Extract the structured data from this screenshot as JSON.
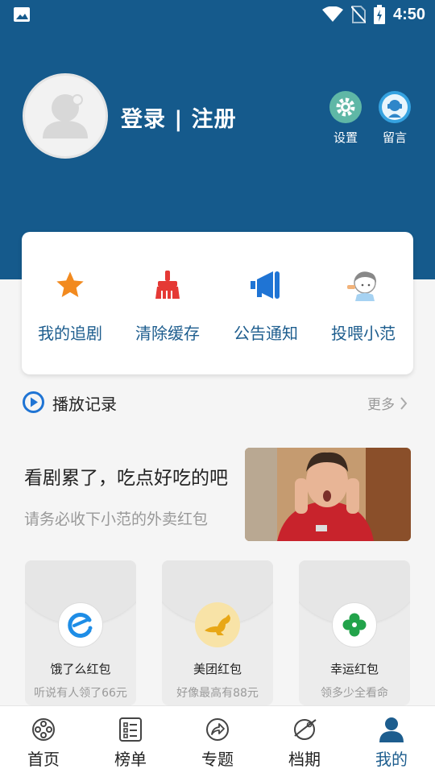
{
  "status_bar": {
    "time": "4:50"
  },
  "profile": {
    "login_label": "登录 | 注册"
  },
  "header_actions": [
    {
      "label": "设置",
      "icon": "gear-icon",
      "color": "#5fb7a6"
    },
    {
      "label": "留言",
      "icon": "headset-icon",
      "color": "#35a2e0"
    }
  ],
  "quick_actions": [
    {
      "label": "我的追剧",
      "icon": "star-icon",
      "color": "#f28a1f"
    },
    {
      "label": "清除缓存",
      "icon": "broom-icon",
      "color": "#e53935"
    },
    {
      "label": "公告通知",
      "icon": "megaphone-icon",
      "color": "#1f74d4"
    },
    {
      "label": "投喂小范",
      "icon": "girl-eating-icon",
      "color": "#f2b37a"
    }
  ],
  "history": {
    "title": "播放记录",
    "more": "更多"
  },
  "promo": {
    "title": "看剧累了，吃点好吃的吧",
    "subtitle": "请务必收下小范的外卖红包"
  },
  "red_packets": [
    {
      "name": "饿了么红包",
      "desc": "听说有人领了66元",
      "icon": "eleme-icon",
      "color": "#1e8de6"
    },
    {
      "name": "美团红包",
      "desc": "好像最高有88元",
      "icon": "kangaroo-icon",
      "color": "#f5b800"
    },
    {
      "name": "幸运红包",
      "desc": "领多少全看命",
      "icon": "clover-icon",
      "color": "#22a34a"
    }
  ],
  "nav": [
    {
      "label": "首页",
      "icon": "film-reel-icon",
      "active": false
    },
    {
      "label": "榜单",
      "icon": "list-icon",
      "active": false
    },
    {
      "label": "专题",
      "icon": "share-arrow-icon",
      "active": false
    },
    {
      "label": "档期",
      "icon": "planet-icon",
      "active": false
    },
    {
      "label": "我的",
      "icon": "user-icon",
      "active": true
    }
  ],
  "colors": {
    "primary": "#155a8c",
    "accent": "#1d5d8e"
  }
}
